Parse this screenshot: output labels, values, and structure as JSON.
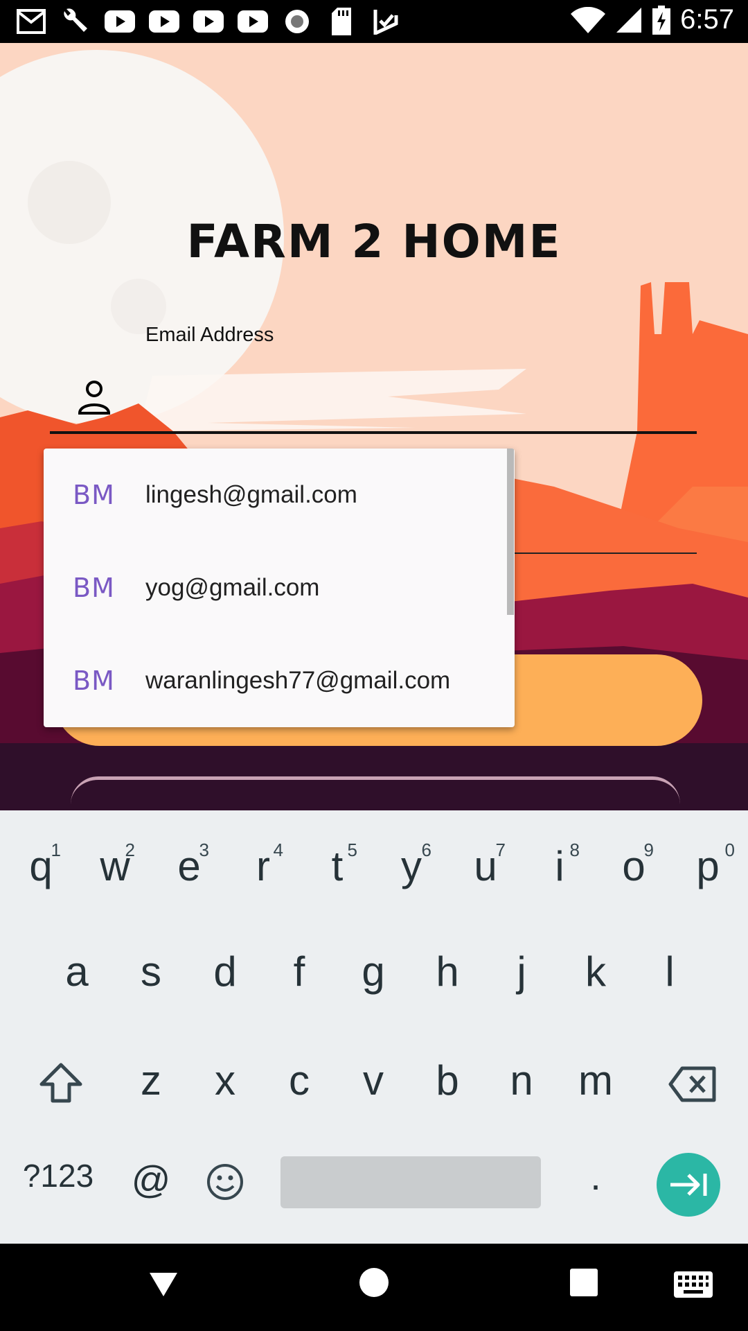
{
  "status_bar": {
    "time": "6:57",
    "icons": [
      "gmail-icon",
      "wrench-icon",
      "youtube-icon",
      "youtube-icon",
      "youtube-icon",
      "youtube-icon",
      "record-icon",
      "sd-card-icon",
      "check-icon"
    ],
    "right_icons": [
      "wifi-icon",
      "signal-icon",
      "battery-charging-icon"
    ]
  },
  "app": {
    "title": "FARM 2 HOME",
    "email_label": "Email Address",
    "email_value": ""
  },
  "autocomplete": {
    "items": [
      {
        "badge": "BM",
        "text": "lingesh@gmail.com"
      },
      {
        "badge": "BM",
        "text": "yog@gmail.com"
      },
      {
        "badge": "BM",
        "text": "waranlingesh77@gmail.com"
      }
    ]
  },
  "keyboard": {
    "row1": [
      "q",
      "w",
      "e",
      "r",
      "t",
      "y",
      "u",
      "i",
      "o",
      "p"
    ],
    "row1_hints": [
      "1",
      "2",
      "3",
      "4",
      "5",
      "6",
      "7",
      "8",
      "9",
      "0"
    ],
    "row2": [
      "a",
      "s",
      "d",
      "f",
      "g",
      "h",
      "j",
      "k",
      "l"
    ],
    "row3": [
      "z",
      "x",
      "c",
      "v",
      "b",
      "n",
      "m"
    ],
    "symbols": "?123",
    "at": "@",
    "period": "."
  },
  "colors": {
    "sky": "#fcd6c2",
    "accent_button": "#fdaf57",
    "enter_key": "#2bb7a5",
    "badge": "#7a59c4"
  }
}
